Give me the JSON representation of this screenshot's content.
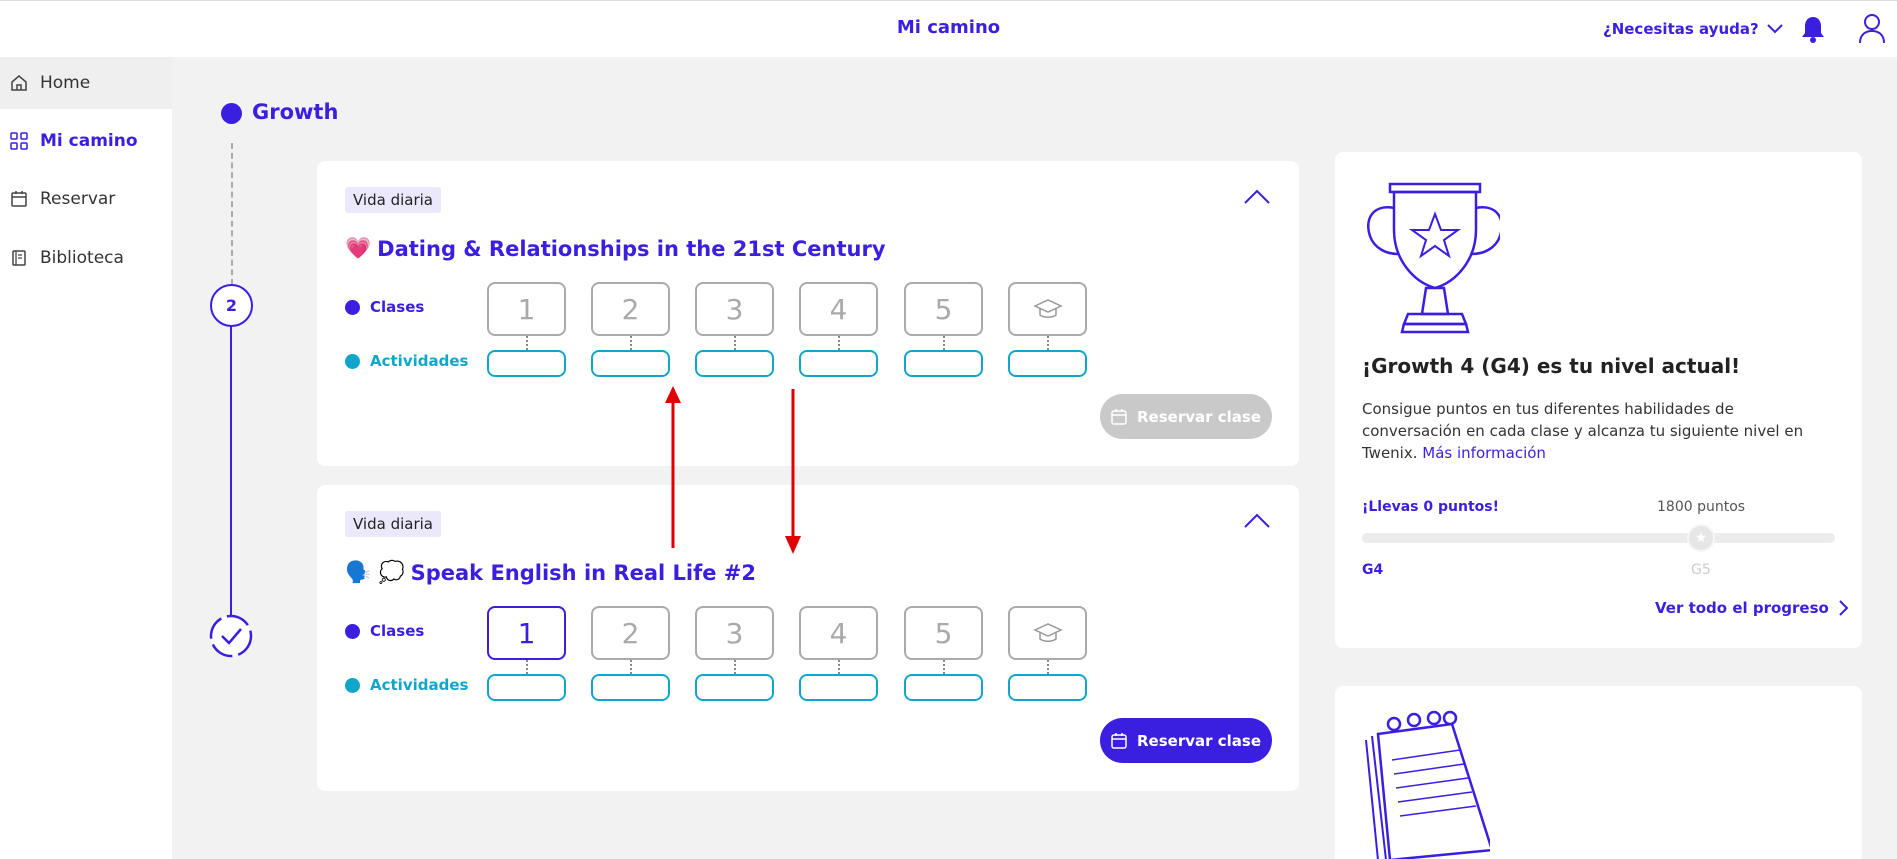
{
  "header": {
    "title": "Mi camino",
    "help_label": "¿Necesitas ayuda?"
  },
  "sidebar": {
    "items": [
      {
        "label": "Home",
        "icon": "home-icon",
        "active": false
      },
      {
        "label": "Mi camino",
        "icon": "grid-icon",
        "active": true
      },
      {
        "label": "Reservar",
        "icon": "calendar-icon",
        "active": false
      },
      {
        "label": "Biblioteca",
        "icon": "book-icon",
        "active": false
      }
    ]
  },
  "timeline": {
    "stage": "Growth",
    "step_number": "2"
  },
  "courses": [
    {
      "tag": "Vida diaria",
      "emoji": "💗",
      "title": "Dating & Relationships in the 21st Century",
      "classes_label": "Clases",
      "activities_label": "Actividades",
      "class_numbers": [
        "1",
        "2",
        "3",
        "4",
        "5"
      ],
      "reserve_label": "Reservar clase",
      "reserve_enabled": false
    },
    {
      "tag": "Vida diaria",
      "emoji": "🗣️ 💭",
      "title": "Speak English in Real Life #2",
      "classes_label": "Clases",
      "activities_label": "Actividades",
      "class_numbers": [
        "1",
        "2",
        "3",
        "4",
        "5"
      ],
      "reserve_label": "Reservar clase",
      "reserve_enabled": true
    }
  ],
  "level": {
    "title": "¡Growth 4 (G4) es tu nivel actual!",
    "description": "Consigue puntos en tus diferentes habilidades de conversación en cada clase y alcanza tu siguiente nivel en Twenix.",
    "more_link": "Más información",
    "points_label": "¡Llevas 0 puntos!",
    "points_target": "1800 puntos",
    "current_level": "G4",
    "next_level": "G5",
    "progress_fraction": 0,
    "progress_link": "Ver todo el progreso"
  },
  "colors": {
    "accent": "#3a1fe0",
    "activity": "#10a6cc",
    "disabled": "#c9c9c9",
    "annotation_arrow": "#e00000"
  }
}
